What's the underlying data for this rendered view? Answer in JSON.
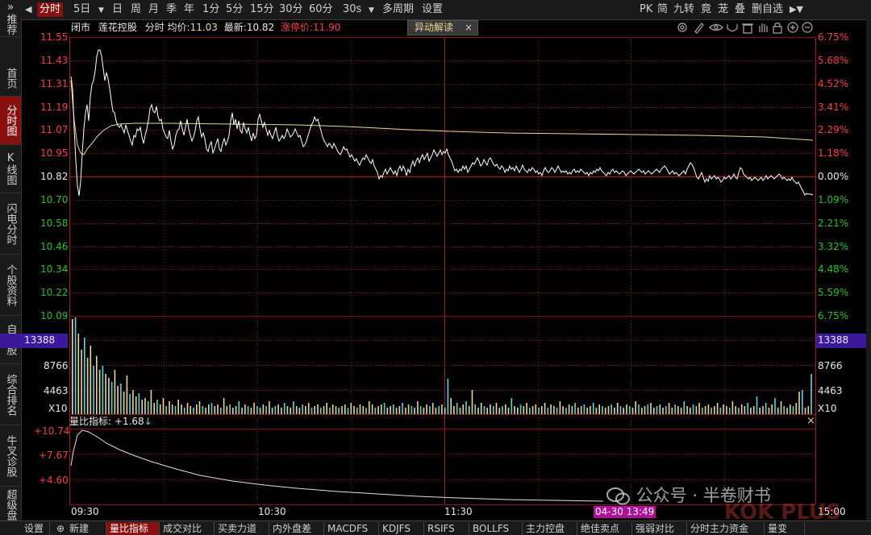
{
  "topbar": {
    "expand_icon": "»",
    "back_icon": "◀",
    "items": [
      "分时",
      "5日",
      "日",
      "周",
      "月",
      "季",
      "年",
      "1分",
      "5分",
      "15分",
      "30分",
      "60分",
      "30s",
      "多周期",
      "设置"
    ],
    "right_items": [
      "PK",
      "简",
      "九转",
      "竟",
      "茏",
      "叠",
      "删自选"
    ],
    "menu_arrow": "▼",
    "right_arrow": "▶▼"
  },
  "sidebar": {
    "items": [
      "推荐",
      "首页",
      "分时图",
      "K线图",
      "闪电分时",
      "个股资料",
      "自选股",
      "综合排名",
      "牛叉诊股",
      "超级盘口"
    ]
  },
  "info": {
    "status": "闭市",
    "stock_name": "莲花控股",
    "mode": "分时",
    "avg_label": "均价:",
    "avg_value": "11.03",
    "latest_label": "最新:",
    "latest_value": "10.82",
    "limit_label": "涨停价:",
    "limit_value": "11.90",
    "anomaly_button": "异动解读",
    "close_glyph": "×"
  },
  "price_axis": {
    "left": [
      "11.55",
      "11.43",
      "11.31",
      "11.19",
      "11.07",
      "10.95",
      "10.82",
      "10.70",
      "10.58",
      "10.46",
      "10.34",
      "10.22",
      "10.09"
    ],
    "right": [
      "6.75%",
      "5.68%",
      "4.52%",
      "3.41%",
      "2.29%",
      "1.18%",
      "0.00%",
      "1.09%",
      "2.21%",
      "3.32%",
      "4.48%",
      "5.59%",
      "6.75%"
    ]
  },
  "volume_axis": {
    "highlight": "13388",
    "mid": "8766",
    "low": "4463",
    "unit": "X10"
  },
  "ratio_panel": {
    "title": "量比指标:",
    "value": "+1.68",
    "arrow": "↓",
    "labels": [
      "+10.74",
      "+7.67",
      "+4.60"
    ]
  },
  "time_axis": {
    "labels": [
      "09:30",
      "10:30",
      "11:30",
      "15:00"
    ],
    "cursor": "04-30 13:49"
  },
  "watermark": {
    "text": "公众号 · 半卷财书",
    "brand": "KOK PLUS"
  },
  "bottombar": {
    "items": [
      "设置",
      "新建",
      "量比指标",
      "成交对比",
      "买卖力道",
      "内外盘差",
      "MACDFS",
      "KDJFS",
      "RSIFS",
      "BOLLFS",
      "主力控盘",
      "绝佳卖点",
      "强弱对比",
      "分时主力资金",
      "量变"
    ]
  },
  "colors": {
    "price_line": "#ffffff",
    "avg_line": "#e8d890",
    "up": "#ff3c3c",
    "down": "#22c322",
    "volume_up": "#e8d890",
    "volume_down": "#4fd8e8",
    "grid": "#8a1010"
  }
}
